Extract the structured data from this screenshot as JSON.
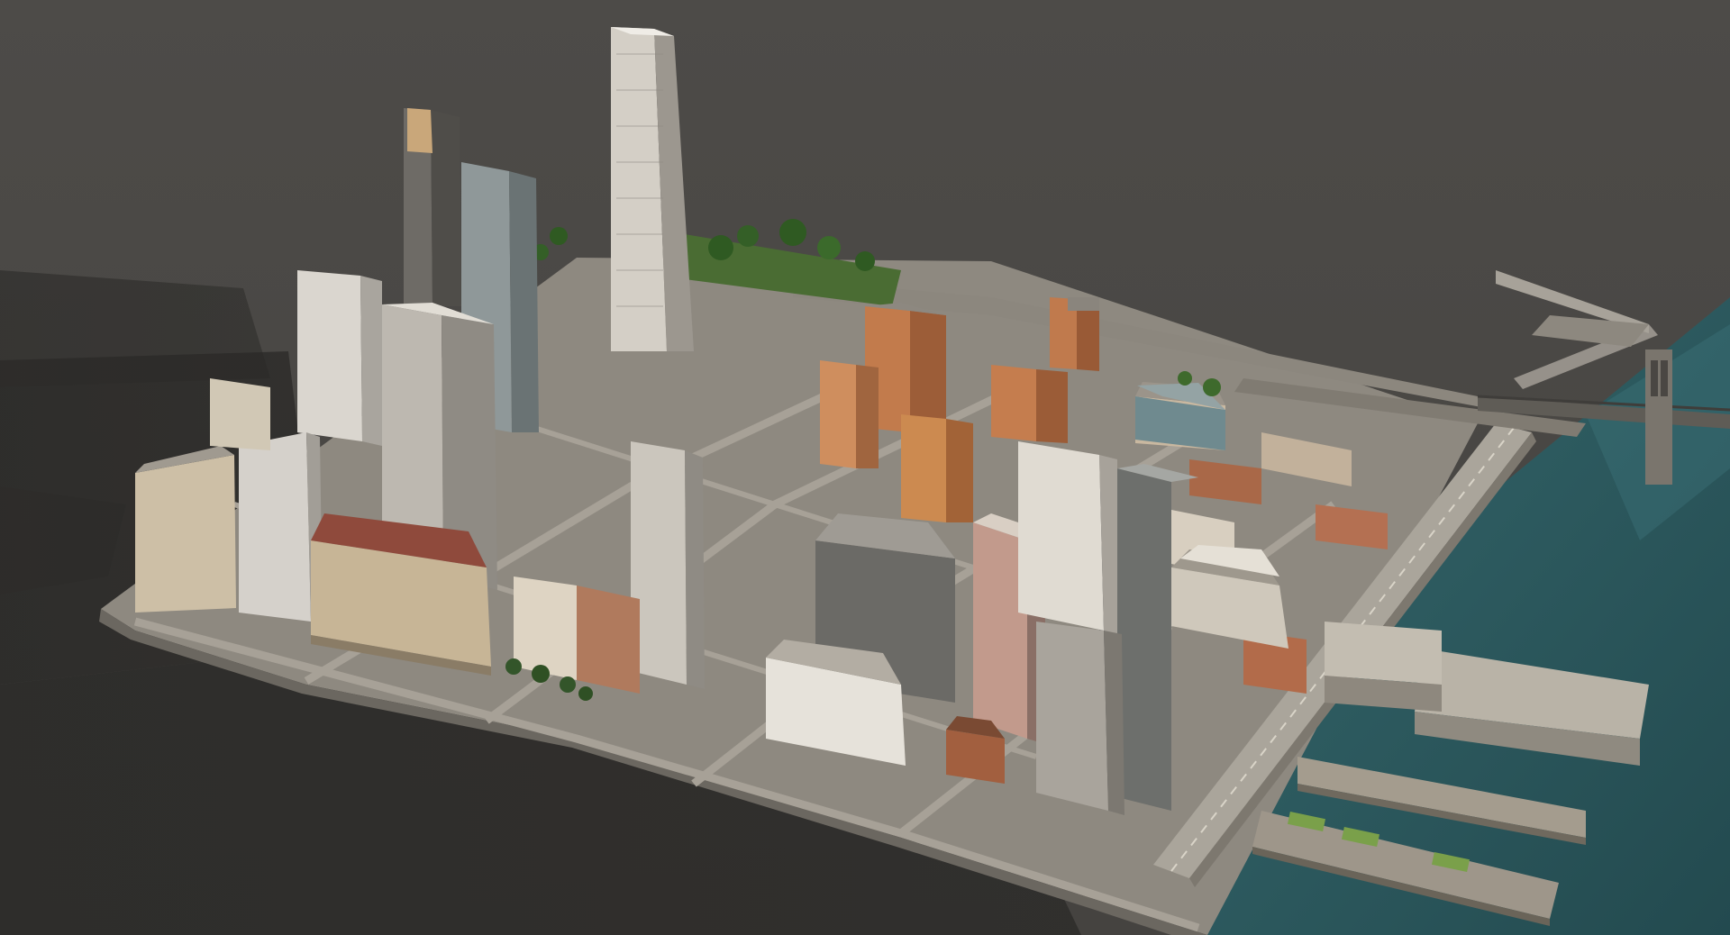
{
  "scene": {
    "subject": "",
    "colors": {
      "ground": "#4a4846",
      "ground_light": "#55534f",
      "shadow": "#2a2927",
      "water": "#2f5d63",
      "water_dark": "#24494e",
      "street": "#9a958c",
      "sidewalk": "#b8b2a6",
      "highway": "#a8a49a",
      "pier": "#a29a8c",
      "park": "#3f6a2c",
      "tree": "#2f5a22",
      "tower_light": "#cfcac2",
      "tower_mid": "#a9a49c",
      "tower_dark": "#6f6c67",
      "glass": "#7d8788",
      "brick": "#b46e48",
      "brick_dark": "#7d4a31",
      "stone": "#d8c7a6",
      "roof": "#8c877f",
      "red_roof": "#8f4a3c",
      "bridge": "#6d6a63"
    }
  }
}
